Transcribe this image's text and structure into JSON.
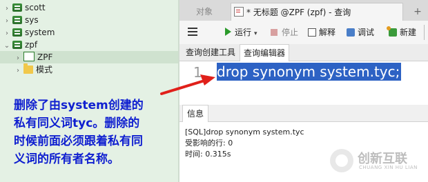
{
  "tree": {
    "items": [
      {
        "arrow": "›",
        "label": "scott"
      },
      {
        "arrow": "›",
        "label": "sys"
      },
      {
        "arrow": "›",
        "label": "system"
      },
      {
        "arrow": "⌄",
        "label": "zpf"
      },
      {
        "arrow": "›",
        "label": "ZPF"
      },
      {
        "arrow": "›",
        "label": "模式"
      }
    ]
  },
  "annotation": {
    "lines": [
      "删除了由system创建的",
      "私有同义词tyc。删除的",
      "时候前面必须跟着私有同",
      "义词的所有者名称。"
    ]
  },
  "tabs": {
    "objects": "对象",
    "query": "* 无标题 @ZPF (zpf) - 查询",
    "new_tab": "+"
  },
  "toolbar": {
    "run": "运行",
    "run_dropdown": "▾",
    "stop": "停止",
    "explain": "解释",
    "debug": "调试",
    "new": "新建"
  },
  "subtabs": {
    "builder": "查询创建工具",
    "editor": "查询编辑器"
  },
  "editor": {
    "line_number": "1",
    "code": "drop synonym system.tyc;"
  },
  "info": {
    "tab": "信息",
    "messages": [
      "[SQL]drop synonym system.tyc",
      "受影响的行: 0",
      "时间: 0.315s"
    ]
  },
  "watermark": {
    "cn": "创新互联",
    "en": "CHUANG XIN HU LIAN"
  },
  "colors": {
    "tree_bg": "#e4f1e4",
    "annotation": "#1020d0",
    "selection": "#2d62c4",
    "arrow": "#e0201a"
  }
}
